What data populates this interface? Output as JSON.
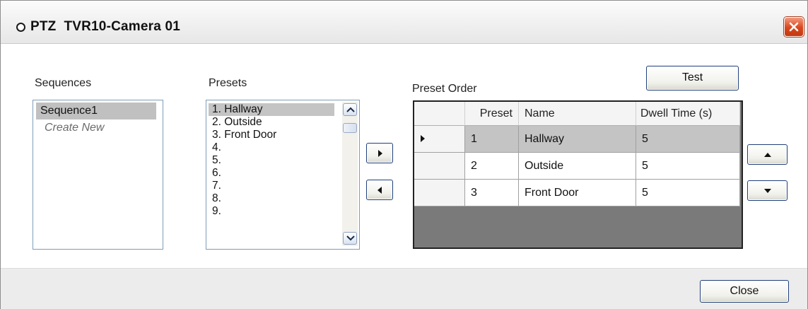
{
  "window": {
    "title": "PTZ  TVR10-Camera 01"
  },
  "sequences": {
    "label": "Sequences",
    "items": [
      {
        "label": "Sequence1",
        "selected": true
      },
      {
        "label": "Create New",
        "selected": false
      }
    ]
  },
  "presets": {
    "label": "Presets",
    "items": [
      "1. Hallway",
      "2. Outside",
      "3. Front Door",
      "4.",
      "5.",
      "6.",
      "7.",
      "8.",
      "9."
    ],
    "selected_index": 0
  },
  "preset_order": {
    "label": "Preset Order",
    "columns": [
      "Preset",
      "Name",
      "Dwell Time (s)"
    ],
    "rows": [
      {
        "preset": "1",
        "name": "Hallway",
        "dwell": "5",
        "current": true
      },
      {
        "preset": "2",
        "name": "Outside",
        "dwell": "5",
        "current": false
      },
      {
        "preset": "3",
        "name": "Front Door",
        "dwell": "5",
        "current": false
      }
    ]
  },
  "buttons": {
    "test": "Test",
    "close": "Close",
    "add_icon": "triangle-right-icon",
    "remove_icon": "triangle-left-icon",
    "move_up_icon": "triangle-up-icon",
    "move_down_icon": "triangle-down-icon"
  },
  "colors": {
    "close_button": "#d8461c",
    "selection": "#c4c4c4",
    "grid_empty_area": "#7a7a7a",
    "footer": "#ececec"
  }
}
